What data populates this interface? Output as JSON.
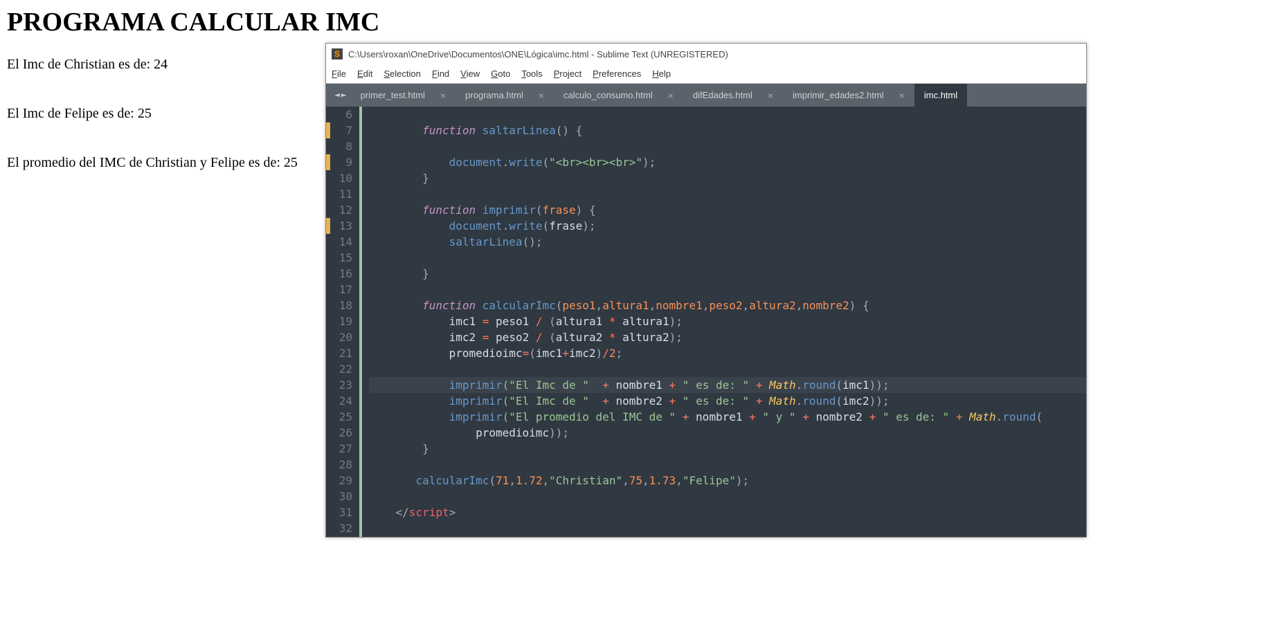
{
  "page": {
    "title": "PROGRAMA CALCULAR IMC",
    "line1": "El Imc de Christian es de: 24",
    "line2": "El Imc de Felipe es de: 25",
    "line3": "El promedio del IMC de Christian y Felipe es de: 25"
  },
  "sublime": {
    "title": "C:\\Users\\roxan\\OneDrive\\Documentos\\ONE\\Lógica\\imc.html - Sublime Text (UNREGISTERED)",
    "menu": [
      "File",
      "Edit",
      "Selection",
      "Find",
      "View",
      "Goto",
      "Tools",
      "Project",
      "Preferences",
      "Help"
    ],
    "tabs": [
      {
        "label": "primer_test.html",
        "active": false
      },
      {
        "label": "programa.html",
        "active": false
      },
      {
        "label": "calculo_consumo.html",
        "active": false
      },
      {
        "label": "difEdades.html",
        "active": false
      },
      {
        "label": "imprimir_edades2.html",
        "active": false
      },
      {
        "label": "imc.html",
        "active": true
      }
    ],
    "first_line_num": 6,
    "current_line": 23,
    "modified_lines": [
      7,
      9,
      13
    ],
    "code_tokens": [
      [],
      [
        [
          "",
          "        "
        ],
        [
          "kw",
          "function"
        ],
        [
          "",
          " "
        ],
        [
          "fn",
          "saltarLinea"
        ],
        [
          "punc",
          "()"
        ],
        [
          "",
          " "
        ],
        [
          "punc",
          "{"
        ]
      ],
      [],
      [
        [
          "",
          "            "
        ],
        [
          "obj",
          "document"
        ],
        [
          "punc",
          "."
        ],
        [
          "method",
          "write"
        ],
        [
          "punc",
          "("
        ],
        [
          "str",
          "\"<br><br><br>\""
        ],
        [
          "punc",
          ")"
        ],
        [
          "punc",
          ";"
        ]
      ],
      [
        [
          "",
          "        "
        ],
        [
          "punc",
          "}"
        ]
      ],
      [],
      [
        [
          "",
          "        "
        ],
        [
          "kw",
          "function"
        ],
        [
          "",
          " "
        ],
        [
          "fn",
          "imprimir"
        ],
        [
          "punc",
          "("
        ],
        [
          "param",
          "frase"
        ],
        [
          "punc",
          ")"
        ],
        [
          "",
          " "
        ],
        [
          "punc",
          "{"
        ]
      ],
      [
        [
          "",
          "            "
        ],
        [
          "obj",
          "document"
        ],
        [
          "punc",
          "."
        ],
        [
          "method",
          "write"
        ],
        [
          "punc",
          "("
        ],
        [
          "var",
          "frase"
        ],
        [
          "punc",
          ")"
        ],
        [
          "punc",
          ";"
        ]
      ],
      [
        [
          "",
          "            "
        ],
        [
          "fn",
          "saltarLinea"
        ],
        [
          "punc",
          "()"
        ],
        [
          "punc",
          ";"
        ]
      ],
      [],
      [
        [
          "",
          "        "
        ],
        [
          "punc",
          "}"
        ]
      ],
      [],
      [
        [
          "",
          "        "
        ],
        [
          "kw",
          "function"
        ],
        [
          "",
          " "
        ],
        [
          "fn",
          "calcularImc"
        ],
        [
          "punc",
          "("
        ],
        [
          "param",
          "peso1"
        ],
        [
          "punc",
          ","
        ],
        [
          "param",
          "altura1"
        ],
        [
          "punc",
          ","
        ],
        [
          "param",
          "nombre1"
        ],
        [
          "punc",
          ","
        ],
        [
          "param",
          "peso2"
        ],
        [
          "punc",
          ","
        ],
        [
          "param",
          "altura2"
        ],
        [
          "punc",
          ","
        ],
        [
          "param",
          "nombre2"
        ],
        [
          "punc",
          ")"
        ],
        [
          "",
          " "
        ],
        [
          "punc",
          "{"
        ]
      ],
      [
        [
          "",
          "            "
        ],
        [
          "var",
          "imc1"
        ],
        [
          "",
          " "
        ],
        [
          "op",
          "="
        ],
        [
          "",
          " "
        ],
        [
          "var",
          "peso1"
        ],
        [
          "",
          " "
        ],
        [
          "op",
          "/"
        ],
        [
          "",
          " "
        ],
        [
          "punc",
          "("
        ],
        [
          "var",
          "altura1"
        ],
        [
          "",
          " "
        ],
        [
          "op",
          "*"
        ],
        [
          "",
          " "
        ],
        [
          "var",
          "altura1"
        ],
        [
          "punc",
          ")"
        ],
        [
          "punc",
          ";"
        ]
      ],
      [
        [
          "",
          "            "
        ],
        [
          "var",
          "imc2"
        ],
        [
          "",
          " "
        ],
        [
          "op",
          "="
        ],
        [
          "",
          " "
        ],
        [
          "var",
          "peso2"
        ],
        [
          "",
          " "
        ],
        [
          "op",
          "/"
        ],
        [
          "",
          " "
        ],
        [
          "punc",
          "("
        ],
        [
          "var",
          "altura2"
        ],
        [
          "",
          " "
        ],
        [
          "op",
          "*"
        ],
        [
          "",
          " "
        ],
        [
          "var",
          "altura2"
        ],
        [
          "punc",
          ")"
        ],
        [
          "punc",
          ";"
        ]
      ],
      [
        [
          "",
          "            "
        ],
        [
          "var",
          "promedioimc"
        ],
        [
          "op",
          "="
        ],
        [
          "punc",
          "("
        ],
        [
          "var",
          "imc1"
        ],
        [
          "op",
          "+"
        ],
        [
          "var",
          "imc2"
        ],
        [
          "punc",
          ")"
        ],
        [
          "op",
          "/"
        ],
        [
          "num",
          "2"
        ],
        [
          "punc",
          ";"
        ]
      ],
      [],
      [
        [
          "",
          "            "
        ],
        [
          "fn",
          "imprimir"
        ],
        [
          "punc",
          "("
        ],
        [
          "str",
          "\"El Imc de \""
        ],
        [
          "",
          "  "
        ],
        [
          "op",
          "+"
        ],
        [
          "",
          " "
        ],
        [
          "var",
          "nombre1"
        ],
        [
          "",
          " "
        ],
        [
          "op",
          "+"
        ],
        [
          "",
          " "
        ],
        [
          "str",
          "\" es de: \""
        ],
        [
          "",
          " "
        ],
        [
          "op",
          "+"
        ],
        [
          "",
          " "
        ],
        [
          "type",
          "Math"
        ],
        [
          "punc",
          "."
        ],
        [
          "fn",
          "round"
        ],
        [
          "punc",
          "("
        ],
        [
          "var",
          "imc1"
        ],
        [
          "punc",
          "))"
        ],
        [
          "punc",
          ";"
        ]
      ],
      [
        [
          "",
          "            "
        ],
        [
          "fn",
          "imprimir"
        ],
        [
          "punc",
          "("
        ],
        [
          "str",
          "\"El Imc de \""
        ],
        [
          "",
          "  "
        ],
        [
          "op",
          "+"
        ],
        [
          "",
          " "
        ],
        [
          "var",
          "nombre2"
        ],
        [
          "",
          " "
        ],
        [
          "op",
          "+"
        ],
        [
          "",
          " "
        ],
        [
          "str",
          "\" es de: \""
        ],
        [
          "",
          " "
        ],
        [
          "op",
          "+"
        ],
        [
          "",
          " "
        ],
        [
          "type",
          "Math"
        ],
        [
          "punc",
          "."
        ],
        [
          "fn",
          "round"
        ],
        [
          "punc",
          "("
        ],
        [
          "var",
          "imc2"
        ],
        [
          "punc",
          "))"
        ],
        [
          "punc",
          ";"
        ]
      ],
      [
        [
          "",
          "            "
        ],
        [
          "fn",
          "imprimir"
        ],
        [
          "punc",
          "("
        ],
        [
          "str",
          "\"El promedio del IMC de \""
        ],
        [
          "",
          " "
        ],
        [
          "op",
          "+"
        ],
        [
          "",
          " "
        ],
        [
          "var",
          "nombre1"
        ],
        [
          "",
          " "
        ],
        [
          "op",
          "+"
        ],
        [
          "",
          " "
        ],
        [
          "str",
          "\" y \""
        ],
        [
          "",
          " "
        ],
        [
          "op",
          "+"
        ],
        [
          "",
          " "
        ],
        [
          "var",
          "nombre2"
        ],
        [
          "",
          " "
        ],
        [
          "op",
          "+"
        ],
        [
          "",
          " "
        ],
        [
          "str",
          "\" es de: \""
        ],
        [
          "",
          " "
        ],
        [
          "op",
          "+"
        ],
        [
          "",
          " "
        ],
        [
          "type",
          "Math"
        ],
        [
          "punc",
          "."
        ],
        [
          "fn",
          "round"
        ],
        [
          "punc",
          "("
        ]
      ],
      [
        [
          "",
          "                "
        ],
        [
          "var",
          "promedioimc"
        ],
        [
          "punc",
          "))"
        ],
        [
          "punc",
          ";"
        ]
      ],
      [
        [
          "",
          "        "
        ],
        [
          "punc",
          "}"
        ]
      ],
      [],
      [
        [
          "",
          "       "
        ],
        [
          "fn",
          "calcularImc"
        ],
        [
          "punc",
          "("
        ],
        [
          "num",
          "71"
        ],
        [
          "punc",
          ","
        ],
        [
          "num",
          "1.72"
        ],
        [
          "punc",
          ","
        ],
        [
          "str",
          "\"Christian\""
        ],
        [
          "punc",
          ","
        ],
        [
          "num",
          "75"
        ],
        [
          "punc",
          ","
        ],
        [
          "num",
          "1.73"
        ],
        [
          "punc",
          ","
        ],
        [
          "str",
          "\"Felipe\""
        ],
        [
          "punc",
          ")"
        ],
        [
          "punc",
          ";"
        ]
      ],
      [],
      [
        [
          "",
          "    "
        ],
        [
          "angle",
          "</"
        ],
        [
          "tag",
          "script"
        ],
        [
          "angle",
          ">"
        ]
      ],
      []
    ]
  }
}
